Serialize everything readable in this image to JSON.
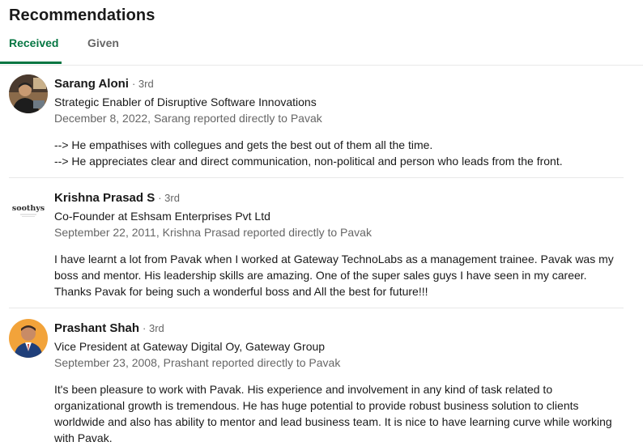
{
  "section": {
    "title": "Recommendations"
  },
  "tabs": [
    {
      "label": "Received",
      "active": true
    },
    {
      "label": "Given",
      "active": false
    }
  ],
  "colors": {
    "accent_green": "#057642",
    "muted_text": "#666666",
    "divider": "#e8e8e8"
  },
  "recommendations": [
    {
      "name": "Sarang Aloni",
      "degree": "· 3rd",
      "headline": "Strategic Enabler of Disruptive Software Innovations",
      "meta": "December 8, 2022, Sarang reported directly to Pavak",
      "text_lines": [
        "--> He empathises with collegues and gets the best out of them all the time.",
        "--> He appreciates clear and direct communication, non-political and person who leads from the front."
      ],
      "avatar": "profile-photo"
    },
    {
      "name": "Krishna Prasad S",
      "degree": "· 3rd",
      "headline": "Co-Founder at Eshsam Enterprises Pvt Ltd",
      "meta": "September 22, 2011, Krishna Prasad reported directly to Pavak",
      "text": "I have learnt a lot from Pavak when I worked at Gateway TechnoLabs as a management trainee. Pavak was my boss and mentor. His leadership skills are amazing. One of the super sales guys I have seen in my career. Thanks Pavak for being such a wonderful boss and All the best for future!!!",
      "avatar": "soothys-logo",
      "logo_text": "soothys"
    },
    {
      "name": "Prashant Shah",
      "degree": "· 3rd",
      "headline": "Vice President at Gateway Digital Oy, Gateway Group",
      "meta": "September 23, 2008, Prashant reported directly to Pavak",
      "text": "It's been pleasure to work with Pavak. His experience and involvement in any kind of task related to organizational growth is tremendous. He has huge potential to provide robust business solution to clients worldwide and also has ability to mentor and lead business team. It is nice to have learning curve while working with Pavak.",
      "avatar": "profile-photo"
    }
  ]
}
